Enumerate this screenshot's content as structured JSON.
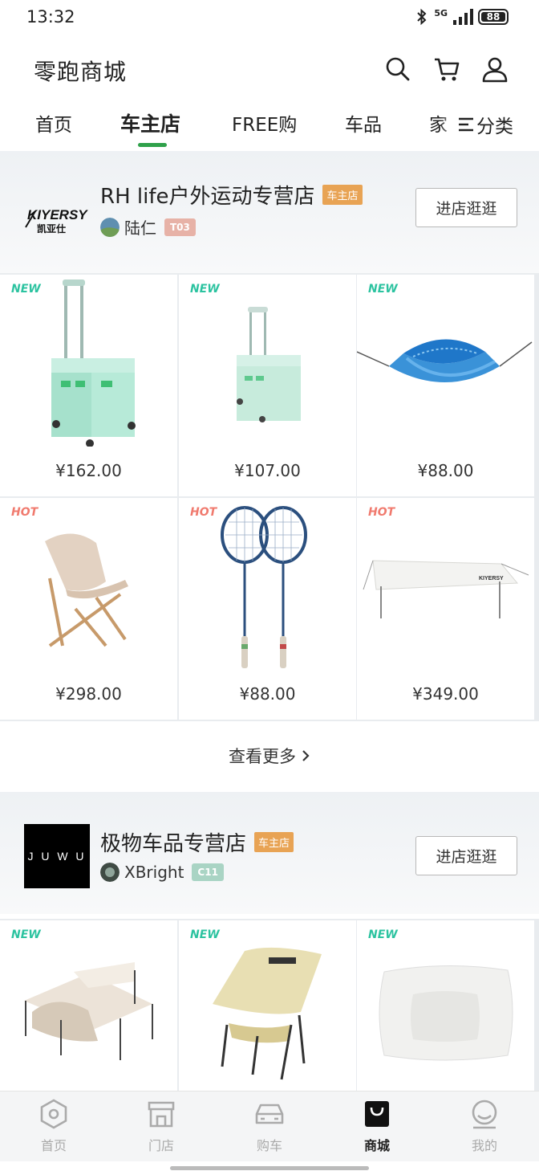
{
  "status_bar": {
    "time": "13:32",
    "network": "5G",
    "battery": "88"
  },
  "header": {
    "title": "零跑商城",
    "icons": [
      "search-icon",
      "cart-icon",
      "user-icon"
    ]
  },
  "tabs": {
    "items": [
      "首页",
      "车主店",
      "FREE购",
      "车品",
      "家"
    ],
    "active": "车主店",
    "classify_label": "分类",
    "accent": "#2fa14a"
  },
  "stores": [
    {
      "name": "RH life户外运动专营店",
      "badge": "车主店",
      "owner": "陆仁",
      "owner_tag": "T03",
      "visit_label": "进店逛逛",
      "products": [
        {
          "tag": "NEW",
          "price": "¥162.00"
        },
        {
          "tag": "NEW",
          "price": "¥107.00"
        },
        {
          "tag": "NEW",
          "price": "¥88.00"
        },
        {
          "tag": "HOT",
          "price": "¥298.00"
        },
        {
          "tag": "HOT",
          "price": "¥88.00"
        },
        {
          "tag": "HOT",
          "price": "¥349.00"
        }
      ]
    },
    {
      "name": "极物车品专营店",
      "badge": "车主店",
      "owner": "XBright",
      "owner_tag": "C11",
      "visit_label": "进店逛逛",
      "logo_text": "J U W U",
      "products": [
        {
          "tag": "NEW"
        },
        {
          "tag": "NEW"
        },
        {
          "tag": "NEW"
        }
      ]
    }
  ],
  "more_label": "查看更多",
  "bottom_nav": {
    "items": [
      "首页",
      "门店",
      "购车",
      "商城",
      "我的"
    ],
    "active": "商城"
  },
  "colors": {
    "badge": "#e8a354",
    "new_tag": "#2cc3a0",
    "hot_tag": "#f07a6e"
  }
}
